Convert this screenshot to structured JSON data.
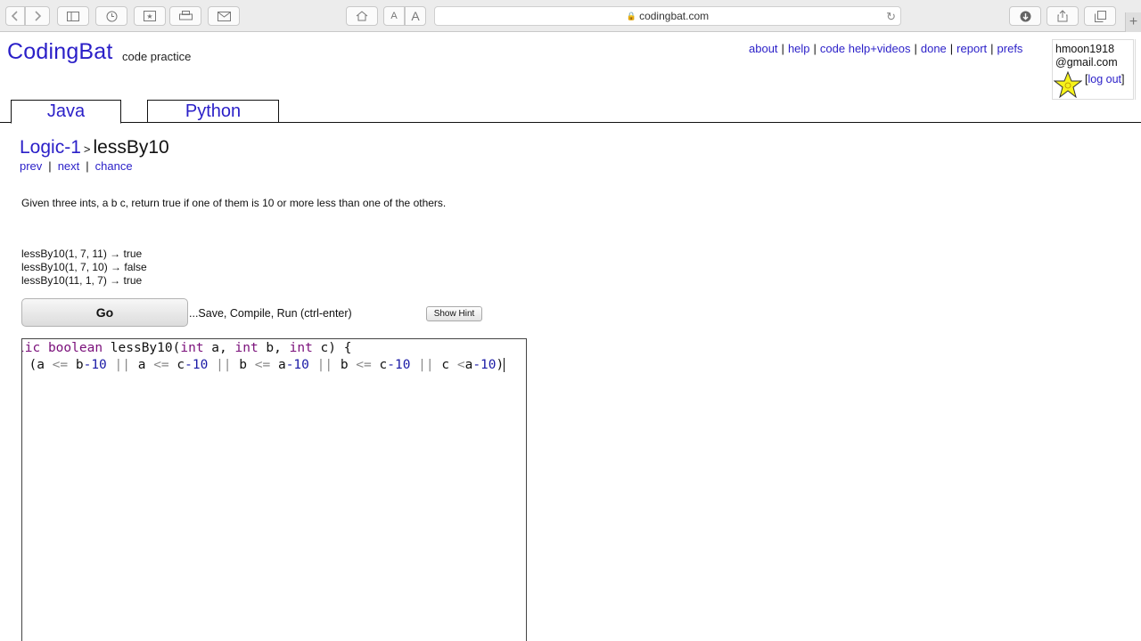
{
  "browser": {
    "url": "codingbat.com"
  },
  "site": {
    "logo": "CodingBat",
    "tagline": "code practice",
    "nav": [
      {
        "label": "about"
      },
      {
        "label": "help"
      },
      {
        "label": "code help+videos"
      },
      {
        "label": "done"
      },
      {
        "label": "report"
      },
      {
        "label": "prefs"
      }
    ],
    "user": {
      "email_line1": "hmoon1918",
      "email_line2": "@gmail.com",
      "logout_label": "log out"
    }
  },
  "tabs": [
    {
      "label": "Java",
      "active": true
    },
    {
      "label": "Python",
      "active": false
    }
  ],
  "problem": {
    "category": "Logic-1",
    "separator": ">",
    "name": "lessBy10",
    "nav": [
      {
        "label": "prev"
      },
      {
        "label": "next"
      },
      {
        "label": "chance"
      }
    ],
    "description": "Given three ints, a b c, return true if one of them is 10 or more less than one of the others.",
    "examples": [
      "lessBy10(1, 7, 11) → true",
      "lessBy10(1, 7, 10) → false",
      "lessBy10(11, 1, 7) → true"
    ],
    "go_label": "Go",
    "go_info": "...Save, Compile, Run (ctrl-enter)",
    "hint_label": "Show Hint"
  },
  "colors": {
    "link": "#2a1fc8",
    "keyword": "#7a0f7a",
    "number": "#1a1aa6"
  }
}
